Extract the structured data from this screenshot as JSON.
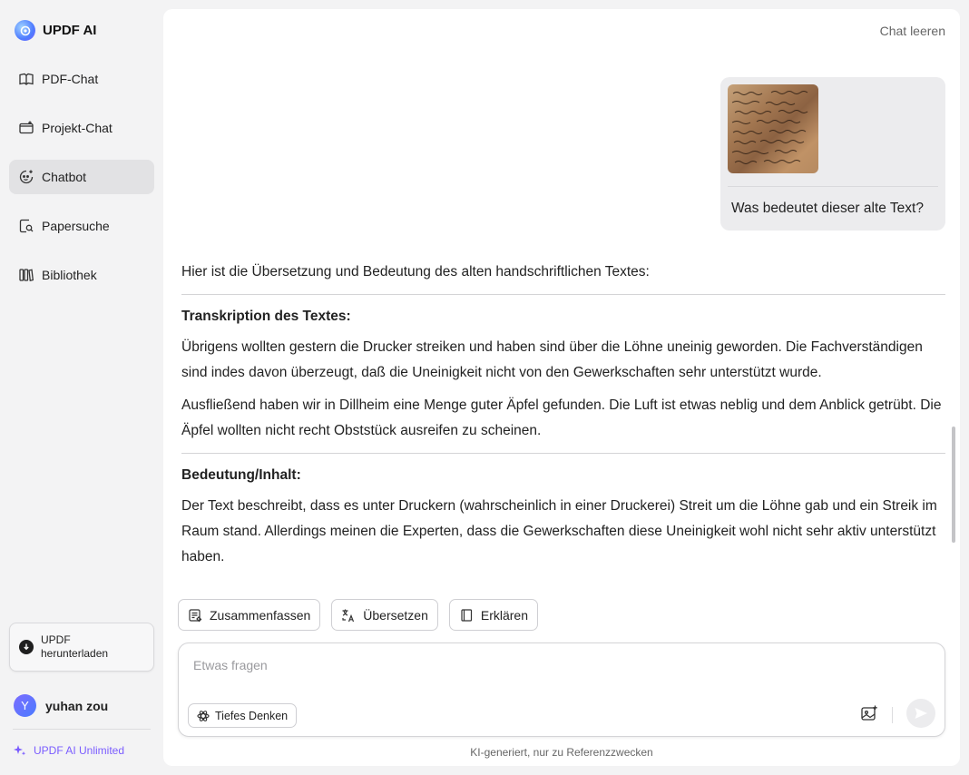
{
  "app": {
    "title": "UPDF AI"
  },
  "sidebar": {
    "items": [
      {
        "label": "PDF-Chat",
        "icon": "book-open-icon"
      },
      {
        "label": "Projekt-Chat",
        "icon": "folder-plus-icon"
      },
      {
        "label": "Chatbot",
        "icon": "chatbot-icon",
        "active": true
      },
      {
        "label": "Papersuche",
        "icon": "doc-search-icon"
      },
      {
        "label": "Bibliothek",
        "icon": "library-icon"
      }
    ],
    "download": {
      "label_line1": "UPDF",
      "label_line2": "herunterladen"
    },
    "user": {
      "initial": "Y",
      "name": "yuhan zou"
    },
    "unlimited": "UPDF AI Unlimited"
  },
  "chat": {
    "clear_label": "Chat leeren",
    "user_message": "Was bedeutet dieser alte Text?",
    "answer": {
      "intro": "Hier ist die Übersetzung und Bedeutung des alten handschriftlichen Textes:",
      "section1_title": "Transkription des Textes:",
      "section1_p1": "Übrigens wollten gestern die Drucker streiken und haben sind über die Löhne uneinig geworden. Die Fachverständigen sind indes davon überzeugt, daß die Uneinigkeit nicht von den Gewerkschaften sehr unterstützt wurde.",
      "section1_p2": "Ausfließend haben wir in Dillheim eine Menge guter Äpfel gefunden. Die Luft ist etwas neblig und dem Anblick getrübt. Die Äpfel wollten nicht recht Obststück ausreifen zu scheinen.",
      "section2_title": "Bedeutung/Inhalt:",
      "section2_p1": "Der Text beschreibt, dass es unter Druckern (wahrscheinlich in einer Druckerei) Streit um die Löhne gab und ein Streik im Raum stand. Allerdings meinen die Experten, dass die Gewerkschaften diese Uneinigkeit wohl nicht sehr aktiv unterstützt haben."
    },
    "actions": {
      "summarize": "Zusammenfassen",
      "translate": "Übersetzen",
      "explain": "Erklären"
    },
    "input": {
      "placeholder": "Etwas fragen",
      "value": "",
      "deep_think": "Tiefes Denken"
    },
    "footnote": "KI-generiert, nur zu Referenzzwecken"
  },
  "colors": {
    "accent": "#7a5cff",
    "sidebar_bg": "#f3f3f4",
    "active_item_bg": "#e2e2e4"
  }
}
